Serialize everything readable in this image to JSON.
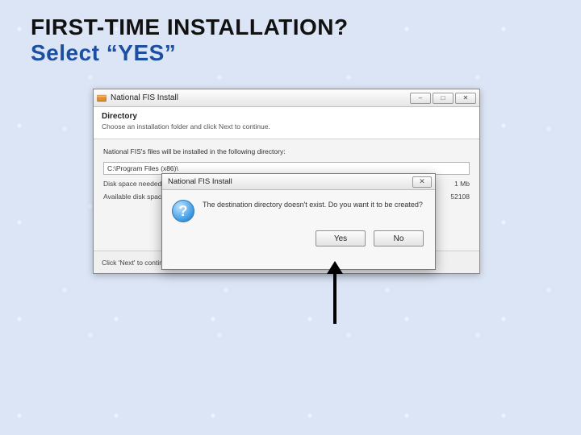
{
  "slide": {
    "heading_line1": "FIRST-TIME INSTALLATION?",
    "heading_line2": "Select “YES”"
  },
  "installer_window": {
    "title": "National FIS Install",
    "controls": {
      "min": "–",
      "max": "□",
      "close": "✕"
    },
    "header": {
      "title": "Directory",
      "subtitle": "Choose an installation folder and click Next to continue."
    },
    "body": {
      "message": "National FIS's files will be installed in the following directory:",
      "path_value": "C:\\Program Files (x86)\\",
      "disk_needed_label": "Disk space needed:",
      "disk_needed_value": "1 Mb",
      "disk_avail_label": "Available disk space:",
      "disk_avail_value": "52108"
    },
    "footer": {
      "hint": "Click 'Next' to continue."
    }
  },
  "modal": {
    "title": "National FIS Install",
    "close_glyph": "✕",
    "icon_name": "question-icon",
    "message": "The destination directory doesn't exist. Do you want it to be created?",
    "yes_label": "Yes",
    "no_label": "No"
  }
}
